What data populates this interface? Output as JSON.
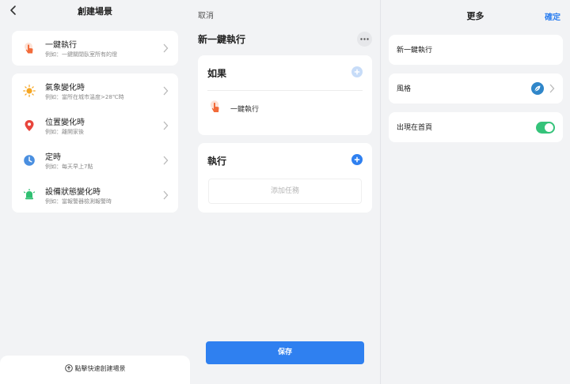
{
  "create_scene": {
    "title": "創建場景",
    "one_key": {
      "title": "一鍵執行",
      "subtitle": "例如：一鍵關閉臥室所有的燈"
    },
    "items": [
      {
        "title": "氣象變化時",
        "subtitle": "例如：當所在城市溫度>28℃時",
        "icon": "sun-icon",
        "color": "#f5a623"
      },
      {
        "title": "位置變化時",
        "subtitle": "例如：離開家後",
        "icon": "location-pin-icon",
        "color": "#e8453c"
      },
      {
        "title": "定時",
        "subtitle": "例如：每天早上7點",
        "icon": "clock-icon",
        "color": "#4a8fe0"
      },
      {
        "title": "設備狀態變化時",
        "subtitle": "例如：當報警器檢測報警時",
        "icon": "device-icon",
        "color": "#2fbf71"
      }
    ],
    "quick_create": "點擊快速創建場景"
  },
  "edit_scene": {
    "cancel": "取消",
    "title": "新一鍵執行",
    "if_section": {
      "title": "如果",
      "item_label": "一鍵執行"
    },
    "exec_section": {
      "title": "執行",
      "add_task": "添加任務"
    },
    "save": "保存"
  },
  "more": {
    "title": "更多",
    "confirm": "確定",
    "name_value": "新一鍵執行",
    "style_label": "風格",
    "show_home_label": "出現在首頁",
    "show_home_on": true
  },
  "colors": {
    "accent": "#2f80f0",
    "toggle_on": "#35c37a",
    "one_key_icon": "#f26b3a"
  }
}
